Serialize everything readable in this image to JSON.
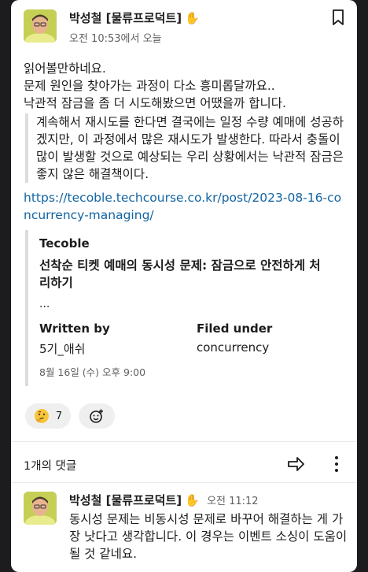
{
  "message": {
    "author": "박성철 [물류프로덕트]",
    "status_emoji": "✋",
    "timestamp": "오전 10:53에서 오늘",
    "lines": [
      "읽어볼만하네요.",
      "문제 원인을 찾아가는 과정이 다소 흥미롭달까요..",
      "낙관적 잠금을 좀 더 시도해봤으면 어땠을까 합니다."
    ],
    "quote": "계속해서 재시도를 한다면 결국에는 일정 수량 예매에 성공하겠지만, 이 과정에서 많은 재시도가 발생한다. 따라서 충돌이 많이 발생할 것으로 예상되는 우리 상황에서는 낙관적 잠금은 좋지 않은 해결책이다.",
    "link": "https://tecoble.techcourse.co.kr/post/2023-08-16-concurrency-managing/"
  },
  "unfurl": {
    "site": "Tecoble",
    "title": "선착순 티켓 예매의 동시성 문제: 잠금으로 안전하게 처리하기",
    "ellipsis": "...",
    "written_by_label": "Written by",
    "written_by_value": "5기_애쉬",
    "filed_under_label": "Filed under",
    "filed_under_value": "concurrency",
    "date": "8월 16일 (수) 오후 9:00"
  },
  "reactions": [
    {
      "emoji": "thinking-face",
      "count": "7"
    }
  ],
  "thread": {
    "reply_count": "1개의 댓글"
  },
  "reply": {
    "author": "박성철 [물류프로덕트]",
    "status_emoji": "✋",
    "timestamp": "오전 11:12",
    "text": "동시성 문제는 비동시성 문제로 바꾸어 해결하는 게 가장 낫다고 생각합니다. 이 경우는 이벤트 소싱이 도움이 될 것 같네요."
  }
}
